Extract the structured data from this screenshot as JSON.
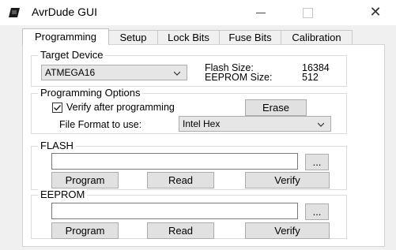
{
  "window": {
    "title": "AvrDude GUI",
    "controls": {
      "minimize": "—",
      "maximize": "□",
      "close": "✕"
    }
  },
  "tabs": [
    {
      "label": "Programming",
      "active": true
    },
    {
      "label": "Setup",
      "active": false
    },
    {
      "label": "Lock Bits",
      "active": false
    },
    {
      "label": "Fuse Bits",
      "active": false
    },
    {
      "label": "Calibration",
      "active": false
    }
  ],
  "target_device": {
    "group_title": "Target Device",
    "selected_device": "ATMEGA16",
    "flash_size_label": "Flash Size:",
    "flash_size_value": "16384",
    "eeprom_size_label": "EEPROM Size:",
    "eeprom_size_value": "512"
  },
  "programming_options": {
    "group_title": "Programming Options",
    "verify_label": "Verify after programming",
    "verify_checked": true,
    "erase_label": "Erase",
    "file_format_label": "File Format to use:",
    "file_format_value": "Intel Hex"
  },
  "flash": {
    "group_title": "FLASH",
    "file_value": "",
    "browse_label": "...",
    "program_label": "Program",
    "read_label": "Read",
    "verify_label": "Verify"
  },
  "eeprom": {
    "group_title": "EEPROM",
    "file_value": "",
    "browse_label": "...",
    "program_label": "Program",
    "read_label": "Read",
    "verify_label": "Verify"
  },
  "colors": {
    "window_bg": "#f0f0f0",
    "panel_bg": "#ffffff",
    "button_bg": "#e1e1e1",
    "border": "#adadad"
  },
  "icons": {
    "app": "chip-icon",
    "combo_arrow": "chevron-down-icon",
    "check": "check-icon"
  }
}
